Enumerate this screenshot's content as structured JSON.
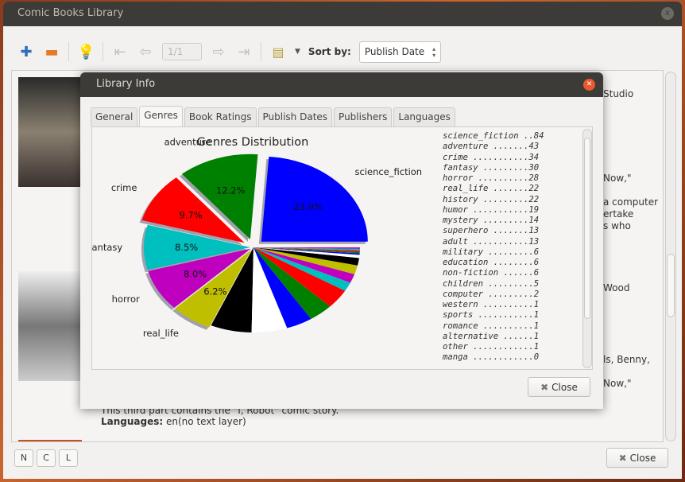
{
  "window": {
    "title": "Comic Books Library",
    "close": "x"
  },
  "toolbar": {
    "add_icon": "plus-icon",
    "open_icon": "folder-icon",
    "page": "1/1",
    "sort_label": "Sort by:",
    "sort_value": "Publish Date"
  },
  "background_text": [
    "Studio",
    "Now,\"",
    "a computer",
    "ertake",
    "s who",
    "Wood",
    "ls, Benny,",
    "Now,\"",
    "This third part contains the \"I, Robot\" comic story."
  ],
  "languages": {
    "label": "Languages:",
    "value": "en(no text layer)"
  },
  "bottom": {
    "n": "N",
    "c": "C",
    "l": "L",
    "close": "Close"
  },
  "dialog": {
    "title": "Library Info",
    "close": "Close",
    "tabs": [
      "General",
      "Genres",
      "Book Ratings",
      "Publish Dates",
      "Publishers",
      "Languages"
    ],
    "active_tab": "Genres",
    "list": [
      [
        "science_fiction",
        84
      ],
      [
        "adventure",
        43
      ],
      [
        "crime",
        34
      ],
      [
        "fantasy",
        30
      ],
      [
        "horror",
        28
      ],
      [
        "real_life",
        22
      ],
      [
        "history",
        22
      ],
      [
        "humor",
        19
      ],
      [
        "mystery",
        14
      ],
      [
        "superhero",
        13
      ],
      [
        "adult",
        13
      ],
      [
        "military",
        6
      ],
      [
        "education",
        6
      ],
      [
        "non-fiction",
        6
      ],
      [
        "children",
        5
      ],
      [
        "computer",
        2
      ],
      [
        "western",
        1
      ],
      [
        "sports",
        1
      ],
      [
        "romance",
        1
      ],
      [
        "alternative",
        1
      ],
      [
        "other",
        1
      ],
      [
        "manga",
        0
      ]
    ]
  },
  "chart_data": {
    "type": "pie",
    "title": "Genres Distribution",
    "categories": [
      "science_fiction",
      "adventure",
      "crime",
      "fantasy",
      "horror",
      "real_life",
      "history",
      "humor",
      "mystery",
      "superhero",
      "adult",
      "military",
      "education",
      "non-fiction",
      "children",
      "computer",
      "western",
      "sports",
      "romance",
      "alternative",
      "other",
      "manga"
    ],
    "values": [
      84,
      43,
      34,
      30,
      28,
      22,
      22,
      19,
      14,
      13,
      13,
      6,
      6,
      6,
      5,
      2,
      1,
      1,
      1,
      1,
      1,
      0
    ],
    "labeled": [
      "science_fiction",
      "adventure",
      "crime",
      "fantasy",
      "horror",
      "real_life"
    ],
    "percent_labels": [
      "23.9%",
      "12.2%",
      "9.7%",
      "8.5%",
      "8.0%",
      "6.2%"
    ],
    "colors": [
      "#0000ff",
      "#008000",
      "#ff0000",
      "#00bfbf",
      "#bf00bf",
      "#bfbf00",
      "#000000",
      "#ffffff"
    ],
    "start_angle": 0,
    "direction": "counterclockwise"
  }
}
